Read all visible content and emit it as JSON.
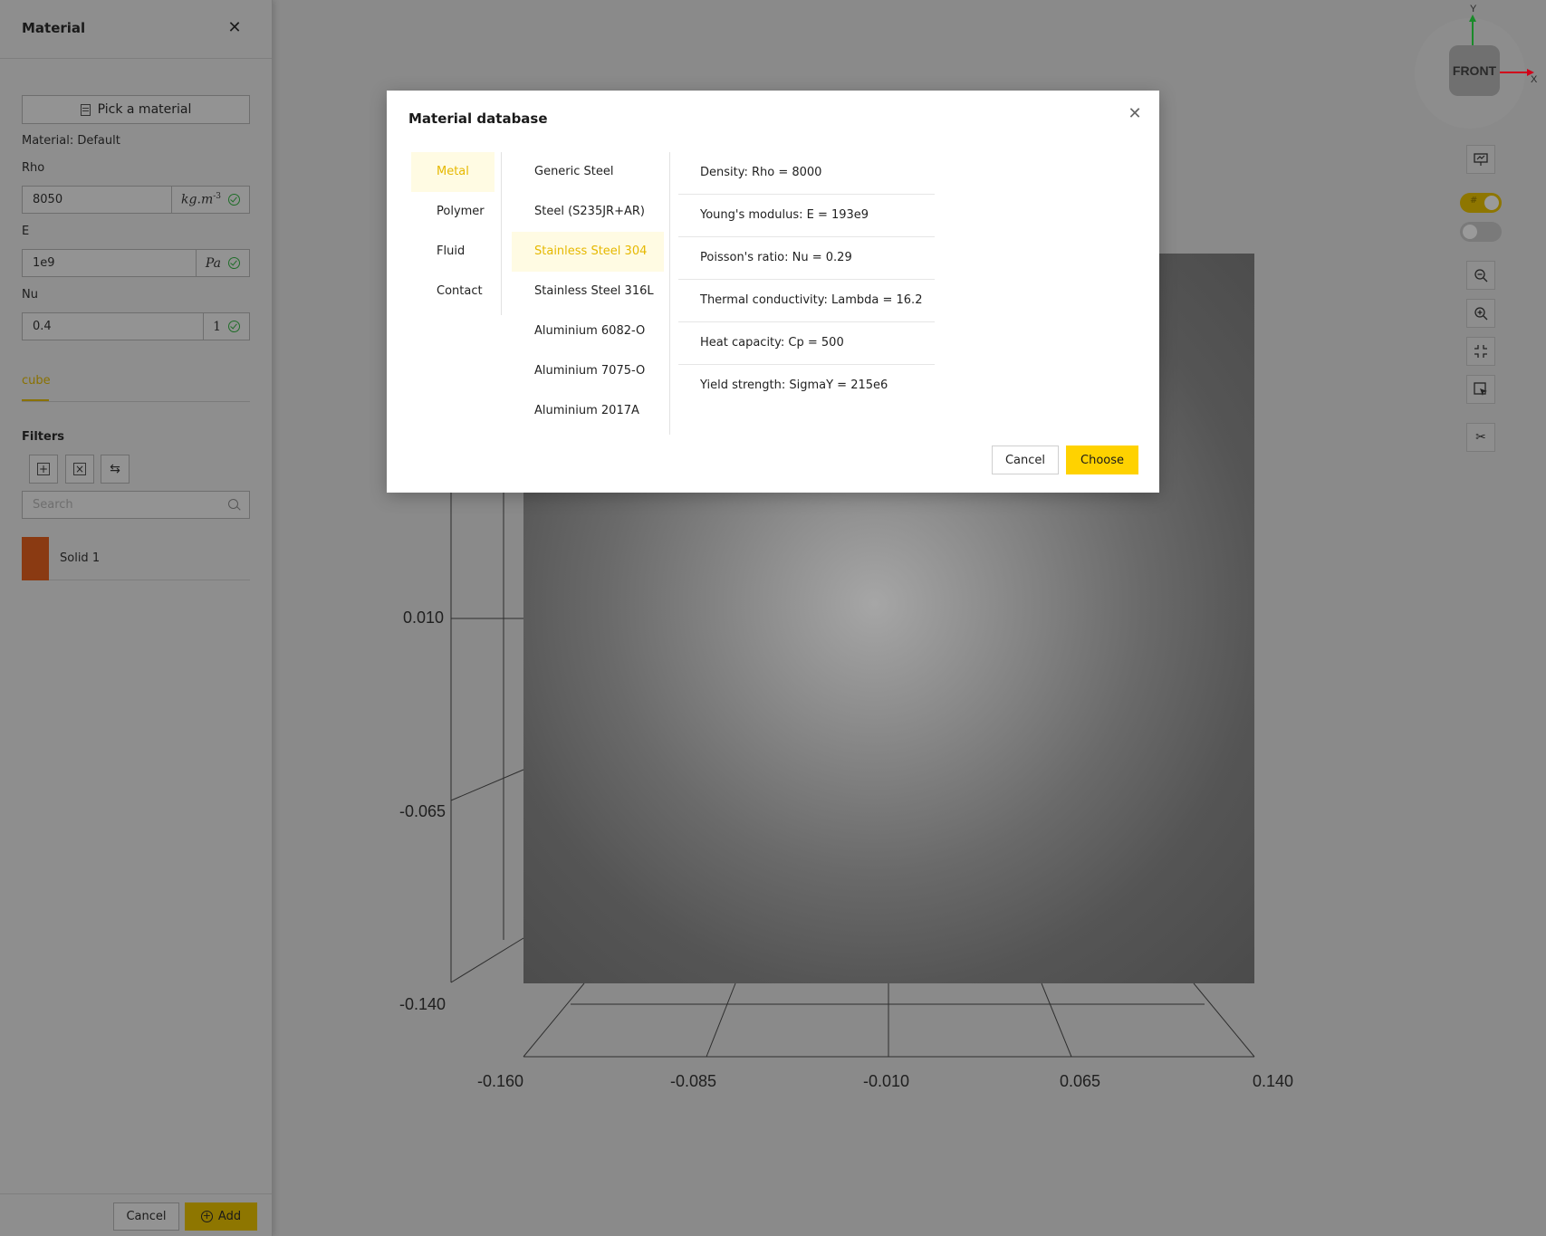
{
  "sidebar": {
    "title": "Material",
    "pick_button": "Pick a material",
    "material_label": "Material: Default",
    "fields": [
      {
        "label": "Rho",
        "value": "8050",
        "unit": "kg.m",
        "unit_sup": "-3"
      },
      {
        "label": "E",
        "value": "1e9",
        "unit": "Pa",
        "unit_sup": ""
      },
      {
        "label": "Nu",
        "value": "0.4",
        "unit": "1",
        "unit_sup": ""
      }
    ],
    "tab": "cube",
    "filters_title": "Filters",
    "search_placeholder": "Search",
    "items": [
      {
        "name": "Solid 1",
        "color": "#c2410c"
      }
    ],
    "cancel_label": "Cancel",
    "add_label": "Add"
  },
  "viewport": {
    "gizmo_face": "FRONT",
    "gizmo_y": "Y",
    "gizmo_x": "X",
    "y_ticks": [
      "0.010",
      "-0.065",
      "-0.140"
    ],
    "x_ticks": [
      "-0.160",
      "-0.085",
      "-0.010",
      "0.065",
      "0.140"
    ],
    "toggle_on_label": "#",
    "colors": {
      "accent": "#ffd200",
      "axis_x": "#d0021b",
      "axis_y": "#1a8a2a"
    }
  },
  "modal": {
    "title": "Material database",
    "categories": [
      "Metal",
      "Polymer",
      "Fluid",
      "Contact"
    ],
    "active_category": "Metal",
    "materials": [
      "Generic Steel",
      "Steel (S235JR+AR)",
      "Stainless Steel 304",
      "Stainless Steel 316L",
      "Aluminium 6082-O",
      "Aluminium 7075-O",
      "Aluminium 2017A"
    ],
    "active_material": "Stainless Steel 304",
    "properties": [
      "Density: Rho = 8000",
      "Young's modulus: E = 193e9",
      "Poisson's ratio: Nu = 0.29",
      "Thermal conductivity: Lambda = 16.2",
      "Heat capacity: Cp = 500",
      "Yield strength: SigmaY = 215e6"
    ],
    "cancel_label": "Cancel",
    "choose_label": "Choose"
  }
}
